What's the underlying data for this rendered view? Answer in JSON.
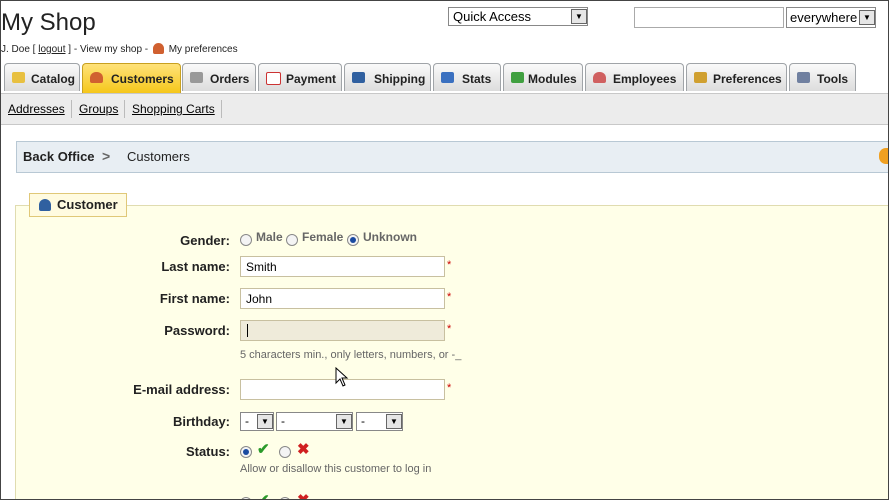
{
  "header": {
    "shop_title": "My Shop",
    "user_name": "J. Doe [",
    "logout": "logout",
    "after_logout": "] - View my shop -",
    "preferences_link": "My preferences",
    "quick_access": "Quick Access",
    "search_value": "",
    "search_scope": "everywhere"
  },
  "tabs": [
    {
      "label": "Catalog",
      "icon": "folder-icon",
      "color": "#e8c040"
    },
    {
      "label": "Customers",
      "icon": "user-icon",
      "color": "#d06030",
      "active": true
    },
    {
      "label": "Orders",
      "icon": "cart-icon",
      "color": "#888888"
    },
    {
      "label": "Payment",
      "icon": "payment-icon",
      "color": "#cc3333"
    },
    {
      "label": "Shipping",
      "icon": "truck-icon",
      "color": "#3060a0"
    },
    {
      "label": "Stats",
      "icon": "chart-icon",
      "color": "#3a70c0"
    },
    {
      "label": "Modules",
      "icon": "puzzle-icon",
      "color": "#40a040"
    },
    {
      "label": "Employees",
      "icon": "employee-icon",
      "color": "#d06060"
    },
    {
      "label": "Preferences",
      "icon": "preferences-icon",
      "color": "#d0a030"
    },
    {
      "label": "Tools",
      "icon": "wrench-icon",
      "color": "#7080a0"
    }
  ],
  "subnav": [
    "Addresses",
    "Groups",
    "Shopping Carts"
  ],
  "breadcrumb": {
    "root": "Back Office",
    "current": "Customers"
  },
  "form": {
    "legend": "Customer",
    "gender_label": "Gender:",
    "gender_options": [
      "Male",
      "Female",
      "Unknown"
    ],
    "gender_selected": "Unknown",
    "lastname_label": "Last name:",
    "lastname_value": "Smith",
    "firstname_label": "First name:",
    "firstname_value": "John",
    "password_label": "Password:",
    "password_value": "",
    "password_hint": "5 characters min., only letters, numbers, or -_",
    "email_label": "E-mail address:",
    "email_value": "",
    "birthday_label": "Birthday:",
    "birthday_day": "-",
    "birthday_month": "-",
    "birthday_year": "-",
    "status_label": "Status:",
    "status_hint": "Allow or disallow this customer to log in",
    "required_mark": "*"
  }
}
